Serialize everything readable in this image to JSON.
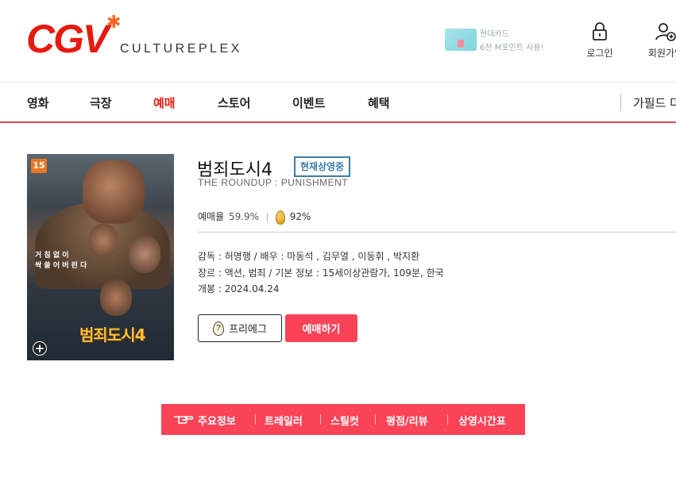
{
  "header": {
    "logo_text": "CGV",
    "logo_sub": "CULTUREPLEX",
    "ad_line1": "현대카드",
    "ad_line2": "6천 M포인트 사용!",
    "login_label": "로그인",
    "join_label": "회원가입"
  },
  "nav": {
    "items": [
      "영화",
      "극장",
      "예매",
      "스토어",
      "이벤트",
      "혜택"
    ],
    "active": "예매",
    "right_label": "가필드 더"
  },
  "movie": {
    "poster": {
      "rating": "15",
      "tagline_1": "거 침 없 이",
      "tagline_2": "싹  쓸 어 버 린 다",
      "poster_title": "범죄도시4"
    },
    "title": "범죄도시4",
    "status_badge": "현재상영중",
    "english_title": "THE ROUNDUP : PUNISHMENT",
    "reservation_rate_label": "예매율",
    "reservation_rate": "59.9%",
    "golden_egg": "92%",
    "director_line": "감독 : 허명행 / 배우 : 마동석 ,  김무열 ,  이동휘 ,  박지환",
    "genre_line": "장르 : 액션, 범죄 / 기본 정보 : 15세이상관람가, 109분, 한국",
    "release_line": "개봉 : 2024.04.24",
    "pre_egg_button": "프리에그",
    "book_button": "예매하기"
  },
  "subtabs": [
    "주요정보",
    "트레일러",
    "스틸컷",
    "평점/리뷰",
    "상영시간표"
  ],
  "colors": {
    "brand_red": "#e71a0f",
    "accent_pink": "#fb4357",
    "badge_blue": "#3d7ca6"
  },
  "icons": {
    "login": "lock-icon",
    "join": "user-plus-icon",
    "subtab_pointer": "hand-pointer-icon",
    "poster_expand": "plus-icon",
    "golden_egg": "egg-icon"
  }
}
